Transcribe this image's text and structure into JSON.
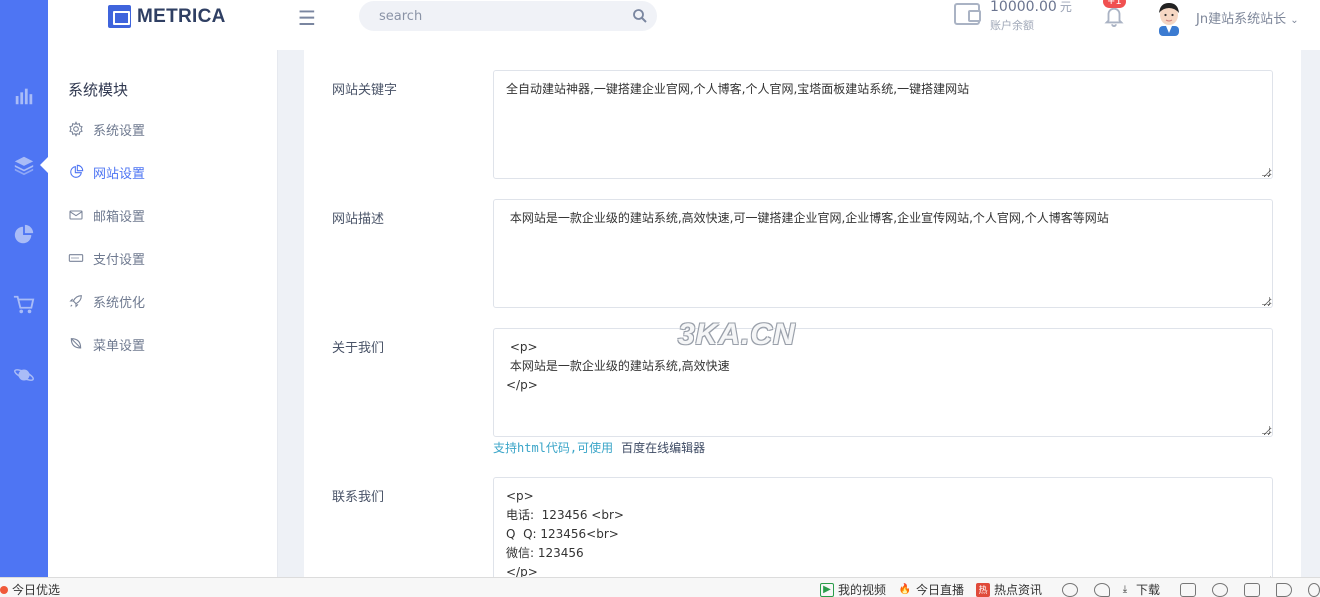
{
  "header": {
    "logo_text": "METRICA",
    "search_placeholder": "search",
    "balance_amount": "10000.00",
    "balance_unit": "元",
    "balance_label": "账户余额",
    "notification_badge": "+1",
    "username": "Jn建站系统站长"
  },
  "subnav": {
    "title": "系统模块",
    "items": [
      {
        "label": "系统设置",
        "icon": "gear-icon"
      },
      {
        "label": "网站设置",
        "icon": "globe-icon",
        "active": true
      },
      {
        "label": "邮箱设置",
        "icon": "mail-icon"
      },
      {
        "label": "支付设置",
        "icon": "card-icon"
      },
      {
        "label": "系统优化",
        "icon": "rocket-icon"
      },
      {
        "label": "菜单设置",
        "icon": "leaf-icon"
      }
    ]
  },
  "form": {
    "keywords_label": "网站关键字",
    "keywords_value": "全自动建站神器,一键搭建企业官网,个人博客,个人官网,宝塔面板建站系统,一键搭建网站",
    "description_label": "网站描述",
    "description_value": " 本网站是一款企业级的建站系统,高效快速,可一键搭建企业官网,企业博客,企业宣传网站,个人官网,个人博客等网站",
    "about_label": "关于我们",
    "about_value": " <p>\n 本网站是一款企业级的建站系统,高效快速\n</p>",
    "html_hint": "支持html代码,可使用",
    "editor_link": "百度在线编辑器",
    "contact_label": "联系我们",
    "contact_value": "<p>\n电话:  123456 <br>\nQ  Q: 123456<br>\n微信: 123456\n</p>"
  },
  "watermark": "3KA.CN",
  "bottombar": {
    "left_label": "今日优选",
    "items": [
      "我的视频",
      "今日直播",
      "热点资讯",
      "下载"
    ]
  },
  "colors": {
    "accent": "#4e75f3",
    "rail": "#4e75f3",
    "hint": "#3aa5c8"
  }
}
